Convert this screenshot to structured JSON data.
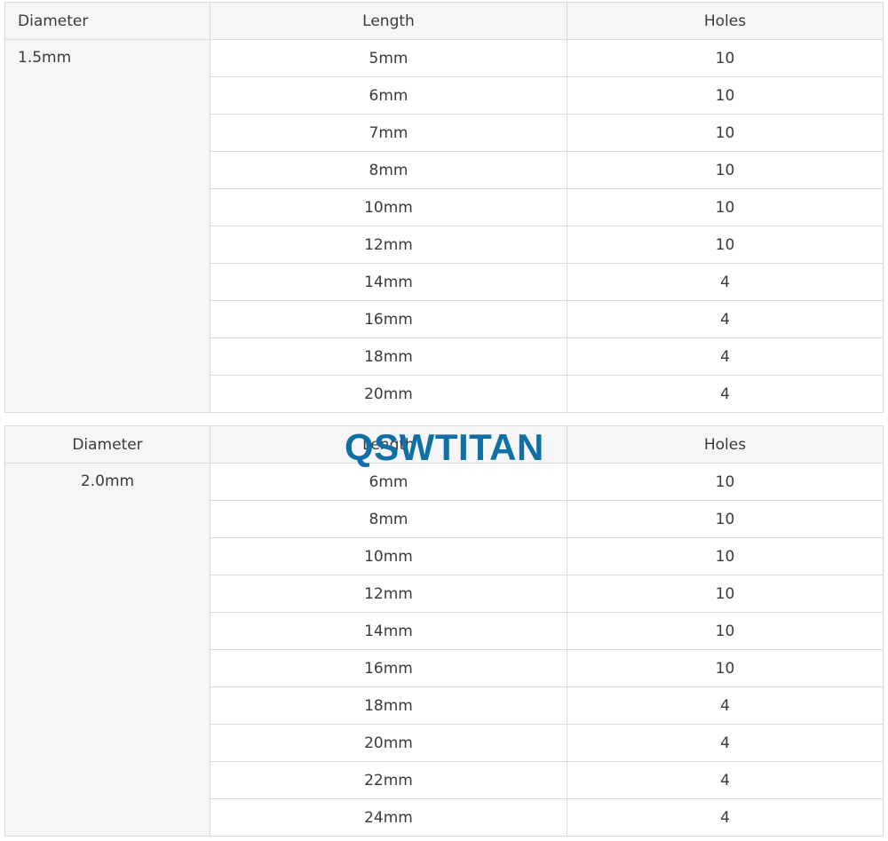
{
  "tables": [
    {
      "headers": {
        "diameter": "Diameter",
        "length": "Length",
        "holes": "Holes"
      },
      "diameter": "1.5mm",
      "rows": [
        {
          "length": "5mm",
          "holes": "10"
        },
        {
          "length": "6mm",
          "holes": "10"
        },
        {
          "length": "7mm",
          "holes": "10"
        },
        {
          "length": "8mm",
          "holes": "10"
        },
        {
          "length": "10mm",
          "holes": "10"
        },
        {
          "length": "12mm",
          "holes": "10"
        },
        {
          "length": "14mm",
          "holes": "4"
        },
        {
          "length": "16mm",
          "holes": "4"
        },
        {
          "length": "18mm",
          "holes": "4"
        },
        {
          "length": "20mm",
          "holes": "4"
        }
      ]
    },
    {
      "headers": {
        "diameter": "Diameter",
        "length": "Length",
        "holes": "Holes"
      },
      "diameter": "2.0mm",
      "rows": [
        {
          "length": "6mm",
          "holes": "10"
        },
        {
          "length": "8mm",
          "holes": "10"
        },
        {
          "length": "10mm",
          "holes": "10"
        },
        {
          "length": "12mm",
          "holes": "10"
        },
        {
          "length": "14mm",
          "holes": "10"
        },
        {
          "length": "16mm",
          "holes": "10"
        },
        {
          "length": "18mm",
          "holes": "4"
        },
        {
          "length": "20mm",
          "holes": "4"
        },
        {
          "length": "22mm",
          "holes": "4"
        },
        {
          "length": "24mm",
          "holes": "4"
        }
      ]
    }
  ],
  "watermark": "QSWTITAN"
}
